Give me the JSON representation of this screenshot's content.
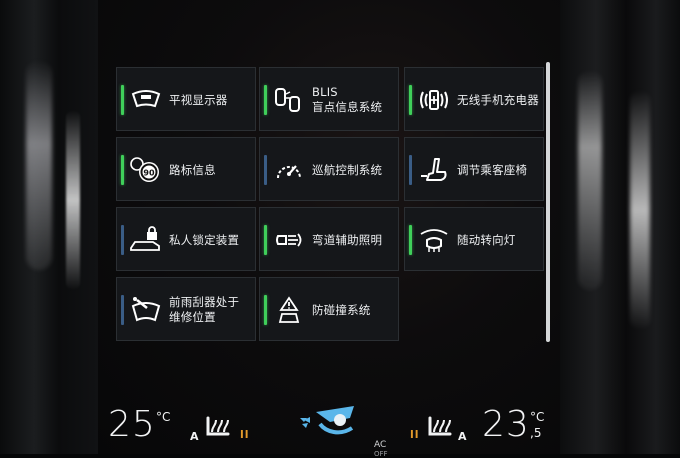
{
  "tiles": [
    {
      "lines": [
        "平视显示器"
      ],
      "state": "on",
      "icon": "head-up-display-icon"
    },
    {
      "lines": [
        "BLIS",
        "盲点信息系统"
      ],
      "state": "on",
      "icon": "blind-spot-icon"
    },
    {
      "lines": [
        "无线手机充电器"
      ],
      "state": "on",
      "icon": "wireless-charging-icon"
    },
    {
      "lines": [
        "路标信息"
      ],
      "state": "on",
      "icon": "speed-sign-icon"
    },
    {
      "lines": [
        "巡航控制系统"
      ],
      "state": "off",
      "icon": "cruise-control-icon"
    },
    {
      "lines": [
        "调节乘客座椅"
      ],
      "state": "off",
      "icon": "passenger-seat-icon"
    },
    {
      "lines": [
        "私人锁定装置"
      ],
      "state": "off",
      "icon": "private-lock-icon"
    },
    {
      "lines": [
        "弯道辅助照明"
      ],
      "state": "on",
      "icon": "cornering-light-icon"
    },
    {
      "lines": [
        "随动转向灯"
      ],
      "state": "on",
      "icon": "active-bending-light-icon"
    },
    {
      "lines": [
        "前雨刮器处于",
        "维修位置"
      ],
      "state": "off",
      "icon": "wiper-service-icon"
    },
    {
      "lines": [
        "防碰撞系统"
      ],
      "state": "on",
      "icon": "collision-warning-icon"
    }
  ],
  "climate": {
    "left_temp": "25",
    "left_unit": "°C",
    "left_auto": "A",
    "left_level": "ll",
    "right_level": "ll",
    "right_auto": "A",
    "right_temp": "23",
    "right_unit": "°C",
    "right_decimal": ",5",
    "ac_label": "AC",
    "ac_sub": "OFF"
  },
  "colors": {
    "indicator_on": "#3fcf5a",
    "indicator_off": "#3a5d86",
    "heat_level": "#e39a2b"
  }
}
